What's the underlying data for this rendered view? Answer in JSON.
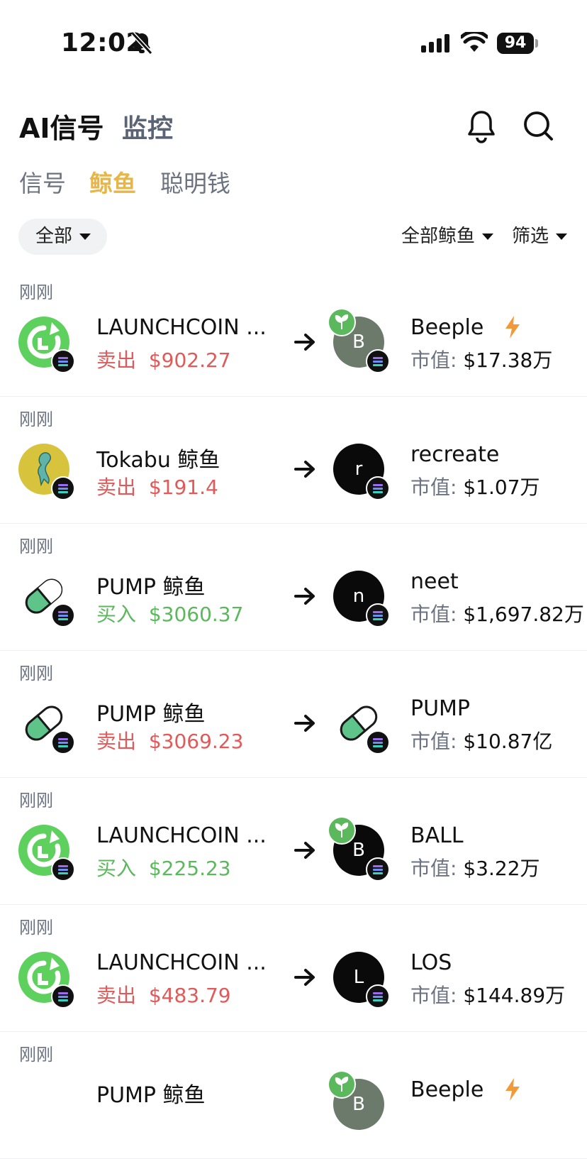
{
  "status_bar": {
    "time": "12:02",
    "battery": "94"
  },
  "header": {
    "title": "AI信号",
    "subtitle": "监控"
  },
  "tabs": [
    {
      "label": "信号",
      "active": false
    },
    {
      "label": "鲸鱼",
      "active": true
    },
    {
      "label": "聪明钱",
      "active": false
    }
  ],
  "filters": {
    "all": "全部",
    "all_whales": "全部鲸鱼",
    "filter": "筛选"
  },
  "market_cap_label": "市值:",
  "colors": {
    "accent": "#e6b64a",
    "sell": "#e05a5a",
    "buy": "#5cb85c"
  },
  "rows": [
    {
      "time": "刚刚",
      "token": "LAUNCHCOIN ...",
      "side": "卖出",
      "amount": "$902.27",
      "dest": "Beeple",
      "dest_initial": "B",
      "mc": "$17.38万",
      "sprout": true,
      "bolt": true,
      "coin_icon": "launchcoin-icon"
    },
    {
      "time": "刚刚",
      "token": "Tokabu 鲸鱼",
      "side": "卖出",
      "amount": "$191.4",
      "dest": "recreate",
      "dest_initial": "r",
      "mc": "$1.07万",
      "sprout": false,
      "bolt": false,
      "coin_icon": "tokabu-icon"
    },
    {
      "time": "刚刚",
      "token": "PUMP 鲸鱼",
      "side": "买入",
      "amount": "$3060.37",
      "dest": "neet",
      "dest_initial": "n",
      "mc": "$1,697.82万",
      "sprout": false,
      "bolt": false,
      "coin_icon": "pump-pill-icon"
    },
    {
      "time": "刚刚",
      "token": "PUMP 鲸鱼",
      "side": "卖出",
      "amount": "$3069.23",
      "dest": "PUMP",
      "dest_initial": "",
      "mc": "$10.87亿",
      "sprout": false,
      "bolt": false,
      "coin_icon": "pump-pill-icon"
    },
    {
      "time": "刚刚",
      "token": "LAUNCHCOIN ...",
      "side": "买入",
      "amount": "$225.23",
      "dest": "BALL",
      "dest_initial": "B",
      "mc": "$3.22万",
      "sprout": true,
      "bolt": false,
      "coin_icon": "launchcoin-icon"
    },
    {
      "time": "刚刚",
      "token": "LAUNCHCOIN ...",
      "side": "卖出",
      "amount": "$483.79",
      "dest": "LOS",
      "dest_initial": "L",
      "mc": "$144.89万",
      "sprout": false,
      "bolt": false,
      "coin_icon": "launchcoin-icon"
    },
    {
      "time": "刚刚",
      "token": "PUMP 鲸鱼",
      "side": "",
      "amount": "",
      "dest": "Beeple",
      "dest_initial": "B",
      "mc": "",
      "sprout": true,
      "bolt": true,
      "coin_icon": "pump-pill-icon"
    }
  ]
}
